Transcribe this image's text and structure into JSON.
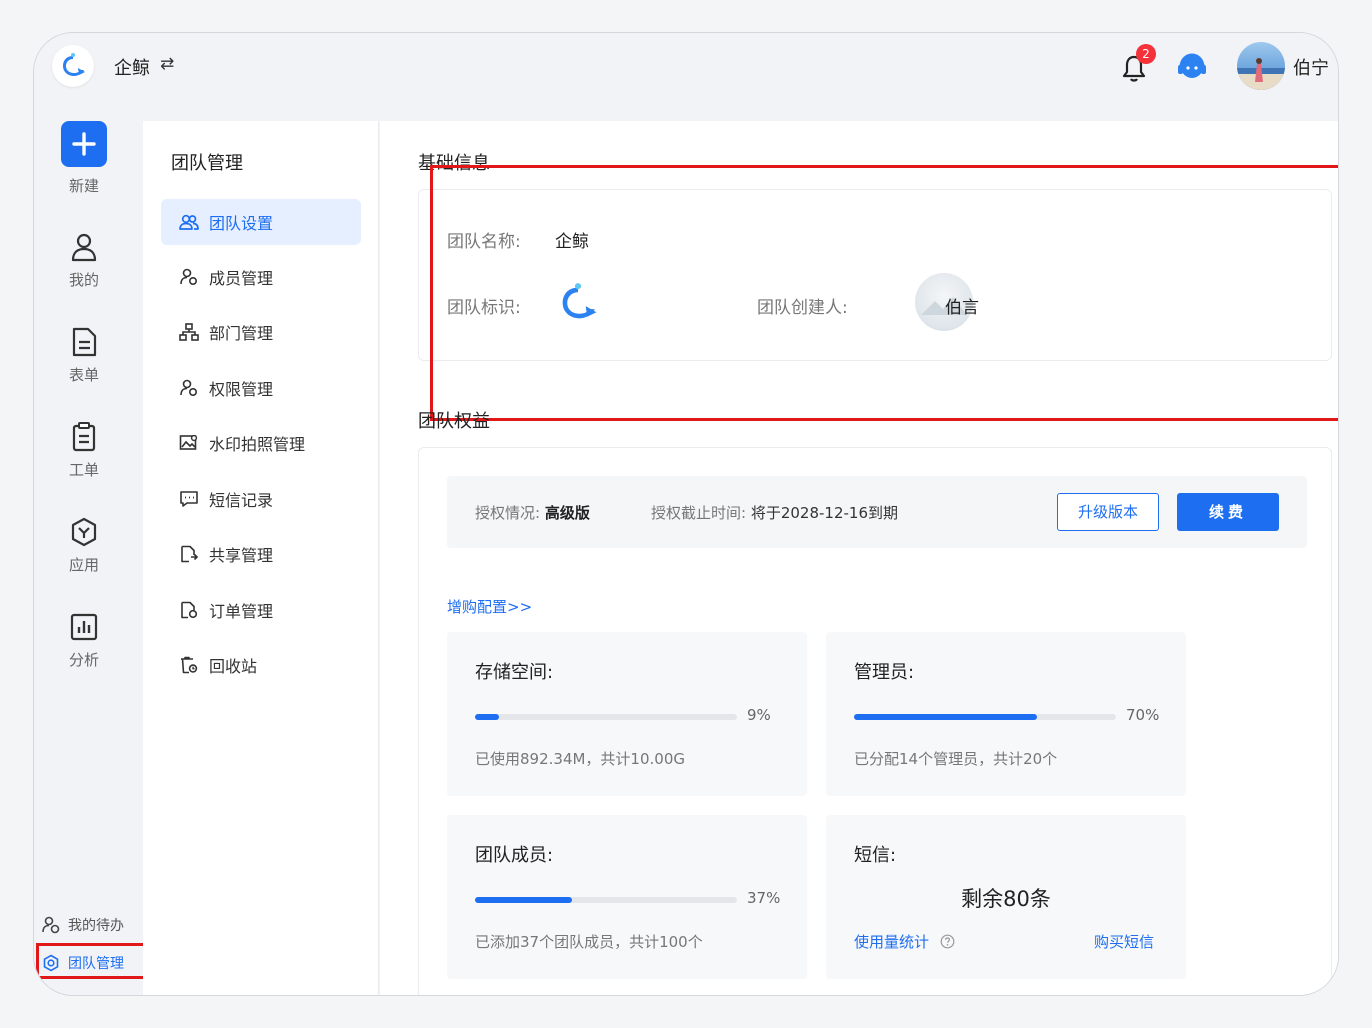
{
  "header": {
    "team_name": "企鲸",
    "notification_count": "2",
    "user_name": "伯宁"
  },
  "rail": {
    "items": [
      {
        "label": "新建",
        "icon": "plus-icon"
      },
      {
        "label": "我的",
        "icon": "user-icon"
      },
      {
        "label": "表单",
        "icon": "document-icon"
      },
      {
        "label": "工单",
        "icon": "clipboard-icon"
      },
      {
        "label": "应用",
        "icon": "app-icon"
      },
      {
        "label": "分析",
        "icon": "chart-icon"
      }
    ],
    "todo_label": "我的待办",
    "team_manage_label": "团队管理"
  },
  "submenu": {
    "title": "团队管理",
    "items": [
      {
        "label": "团队设置",
        "icon": "team-icon",
        "active": true
      },
      {
        "label": "成员管理",
        "icon": "member-icon"
      },
      {
        "label": "部门管理",
        "icon": "org-icon"
      },
      {
        "label": "权限管理",
        "icon": "permission-icon"
      },
      {
        "label": "水印拍照管理",
        "icon": "watermark-icon"
      },
      {
        "label": "短信记录",
        "icon": "message-icon"
      },
      {
        "label": "共享管理",
        "icon": "share-icon"
      },
      {
        "label": "订单管理",
        "icon": "order-icon"
      },
      {
        "label": "回收站",
        "icon": "trash-icon"
      }
    ]
  },
  "basic": {
    "title": "基础信息",
    "name_label": "团队名称:",
    "name_value": "企鲸",
    "mark_label": "团队标识:",
    "creator_label": "团队创建人:",
    "creator_name": "伯言"
  },
  "rights": {
    "title": "团队权益",
    "license_label": "授权情况:",
    "license_value": "高级版",
    "expiry_label": "授权截止时间:",
    "expiry_value": "将于2028-12-16到期",
    "upgrade_label": "升级版本",
    "renew_label": "续费",
    "addon_link": "增购配置>>",
    "storage": {
      "title": "存储空间:",
      "percent": 9,
      "percent_text": "9%",
      "desc": "已使用892.34M，共计10.00G"
    },
    "admins": {
      "title": "管理员:",
      "percent": 70,
      "percent_text": "70%",
      "desc": "已分配14个管理员，共计20个"
    },
    "members": {
      "title": "团队成员:",
      "percent": 37,
      "percent_text": "37%",
      "desc": "已添加37个团队成员，共计100个"
    },
    "sms": {
      "title": "短信:",
      "remaining": "剩余80条",
      "usage_link": "使用量统计",
      "buy_link": "购买短信"
    }
  },
  "colors": {
    "accent": "#1d6ef1",
    "highlight": "#e01818",
    "badge": "#f5313a"
  }
}
